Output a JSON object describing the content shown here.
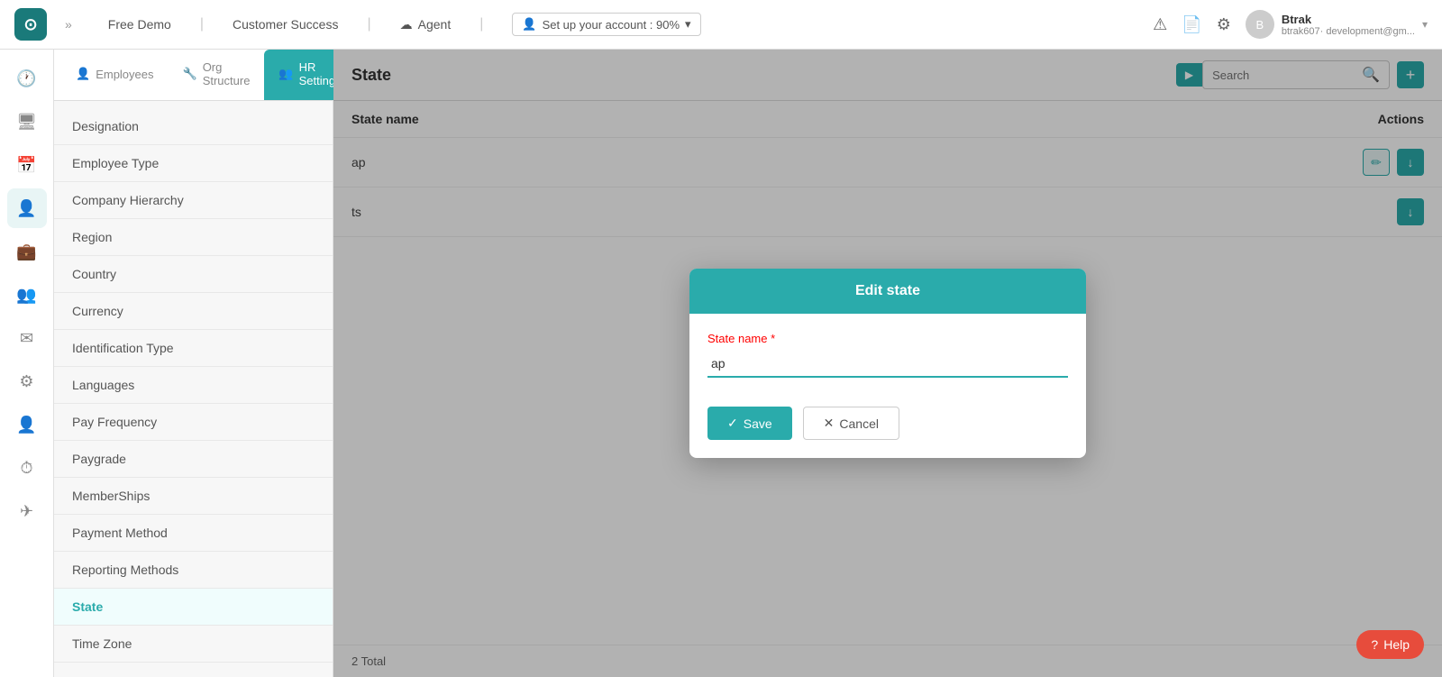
{
  "topnav": {
    "logo_text": "⊙",
    "chevron": "»",
    "links": [
      {
        "id": "free-demo",
        "label": "Free Demo"
      },
      {
        "id": "customer-success",
        "label": "Customer Success"
      },
      {
        "id": "agent",
        "label": "Agent",
        "icon": "☁"
      },
      {
        "id": "setup",
        "label": "Set up your account : 90%",
        "icon": "👤"
      }
    ],
    "icons": [
      "⚠",
      "📄",
      "⚙"
    ],
    "user": {
      "name": "Btrak",
      "email": "btrak607· development@gm..."
    }
  },
  "icon_sidebar": {
    "items": [
      {
        "id": "clock",
        "icon": "🕐",
        "active": false
      },
      {
        "id": "monitor",
        "icon": "🖥",
        "active": false
      },
      {
        "id": "calendar",
        "icon": "📅",
        "active": false
      },
      {
        "id": "person",
        "icon": "👤",
        "active": true
      },
      {
        "id": "briefcase",
        "icon": "💼",
        "active": false
      },
      {
        "id": "team",
        "icon": "👥",
        "active": false
      },
      {
        "id": "mail",
        "icon": "✉",
        "active": false
      },
      {
        "id": "settings2",
        "icon": "⚙",
        "active": false
      },
      {
        "id": "person2",
        "icon": "👤",
        "active": false
      },
      {
        "id": "timer",
        "icon": "⏱",
        "active": false
      },
      {
        "id": "send",
        "icon": "✈",
        "active": false
      }
    ]
  },
  "nav_tabs": [
    {
      "id": "employees",
      "label": "Employees",
      "icon": "👤",
      "active": false
    },
    {
      "id": "org-structure",
      "label": "Org Structure",
      "icon": "🔧",
      "active": false
    },
    {
      "id": "hr-settings",
      "label": "HR Settings",
      "icon": "👥",
      "active": true
    }
  ],
  "nav_list": [
    {
      "id": "designation",
      "label": "Designation",
      "active": false
    },
    {
      "id": "employee-type",
      "label": "Employee Type",
      "active": false
    },
    {
      "id": "company-hierarchy",
      "label": "Company Hierarchy",
      "active": false
    },
    {
      "id": "region",
      "label": "Region",
      "active": false
    },
    {
      "id": "country",
      "label": "Country",
      "active": false
    },
    {
      "id": "currency",
      "label": "Currency",
      "active": false
    },
    {
      "id": "identification-type",
      "label": "Identification Type",
      "active": false
    },
    {
      "id": "languages",
      "label": "Languages",
      "active": false
    },
    {
      "id": "pay-frequency",
      "label": "Pay Frequency",
      "active": false
    },
    {
      "id": "paygrade",
      "label": "Paygrade",
      "active": false
    },
    {
      "id": "memberships",
      "label": "MemberShips",
      "active": false
    },
    {
      "id": "payment-method",
      "label": "Payment Method",
      "active": false
    },
    {
      "id": "reporting-methods",
      "label": "Reporting Methods",
      "active": false
    },
    {
      "id": "state",
      "label": "State",
      "active": true
    },
    {
      "id": "time-zone",
      "label": "Time Zone",
      "active": false
    }
  ],
  "content": {
    "title": "State",
    "search_placeholder": "Search",
    "table": {
      "col_name": "State name",
      "col_actions": "Actions",
      "rows": [
        {
          "id": 1,
          "name": "ap"
        },
        {
          "id": 2,
          "name": "ts"
        }
      ]
    },
    "footer": "2 Total"
  },
  "modal": {
    "title": "Edit state",
    "label": "State name",
    "required": "*",
    "input_value": "ap",
    "save_label": "Save",
    "cancel_label": "Cancel"
  },
  "help": {
    "label": "Help",
    "icon": "?"
  }
}
